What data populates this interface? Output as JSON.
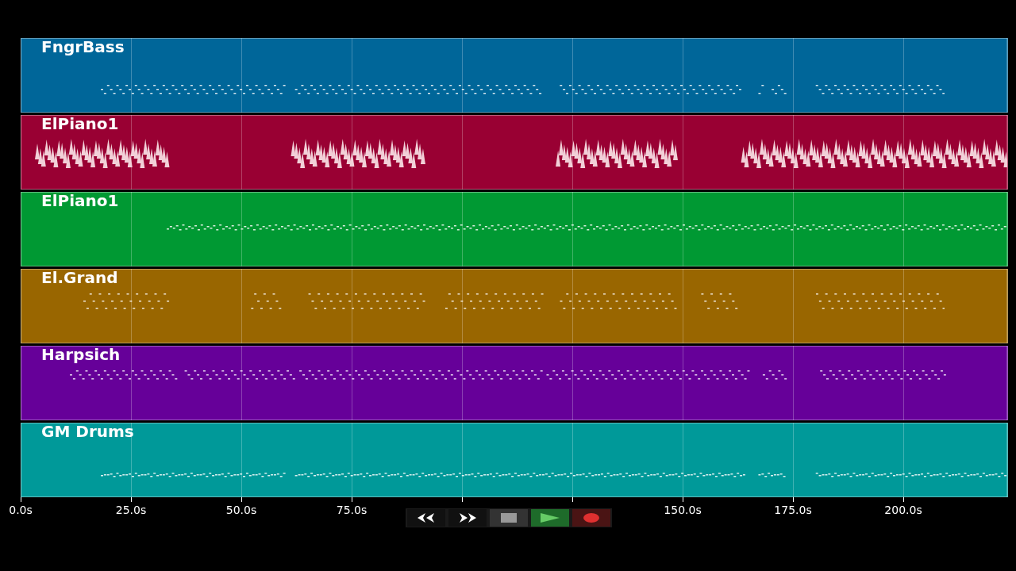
{
  "tracks": [
    {
      "name": "FngrBass",
      "color": "#006699"
    },
    {
      "name": "ElPiano1",
      "color": "#990033"
    },
    {
      "name": "ElPiano1",
      "color": "#009933"
    },
    {
      "name": "El.Grand",
      "color": "#996600"
    },
    {
      "name": "Harpsich",
      "color": "#660099"
    },
    {
      "name": "GM Drums",
      "color": "#009999"
    }
  ],
  "time_axis": {
    "ticks": [
      "0.0s",
      "25.0s",
      "50.0s",
      "75.0s",
      "150.0s",
      "175.0s",
      "200.0s"
    ]
  },
  "transport": [
    {
      "kind": "rewind"
    },
    {
      "kind": "forward"
    },
    {
      "kind": "stop"
    },
    {
      "kind": "play"
    },
    {
      "kind": "record"
    }
  ]
}
